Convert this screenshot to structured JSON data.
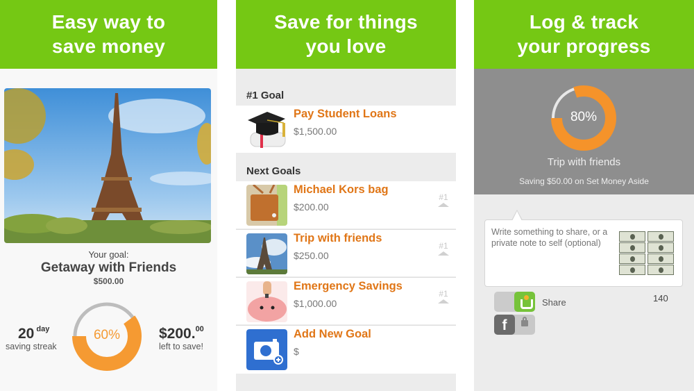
{
  "panels": [
    {
      "header": [
        "Easy way to",
        "save money"
      ],
      "goal_label": "Your goal:",
      "goal_name": "Getaway with Friends",
      "goal_amount": "$500.00",
      "progress_percent": 60,
      "progress_label": "60%",
      "streak_number": "20",
      "streak_unit": "day",
      "streak_label": "saving streak",
      "left_amount": "$200.",
      "left_cents": "00",
      "left_label": "left to save!",
      "photo": "eiffel-tower-photo"
    },
    {
      "header": [
        "Save for things",
        "you love"
      ],
      "top_section": "#1 Goal",
      "top_goal": {
        "title": "Pay Student Loans",
        "amount": "$1,500.00",
        "thumb": "graduation-cap"
      },
      "next_section": "Next Goals",
      "next_goals": [
        {
          "title": "Michael Kors bag",
          "amount": "$200.00",
          "rank": "#1",
          "thumb": "handbag"
        },
        {
          "title": "Trip with friends",
          "amount": "$250.00",
          "rank": "#1",
          "thumb": "eiffel-tower"
        },
        {
          "title": "Emergency Savings",
          "amount": "$1,000.00",
          "rank": "#1",
          "thumb": "piggy-bank"
        }
      ],
      "add_goal": {
        "title": "Add New Goal",
        "amount": "$",
        "thumb": "add-photo"
      }
    },
    {
      "header": [
        "Log & track",
        "your progress"
      ],
      "progress_percent": 80,
      "progress_label": "80%",
      "goal_name": "Trip with friends",
      "saving_line": "Saving $50.00 on Set Money Aside",
      "note_placeholder": "Write something to share, or a private note to self (optional)",
      "share_label": "Share",
      "char_count": "140",
      "facebook_glyph": "f"
    }
  ],
  "colors": {
    "header_green": "#75c814",
    "accent_orange": "#f59a32",
    "title_orange": "#e07617",
    "ring_track": "#bdbdbd"
  }
}
